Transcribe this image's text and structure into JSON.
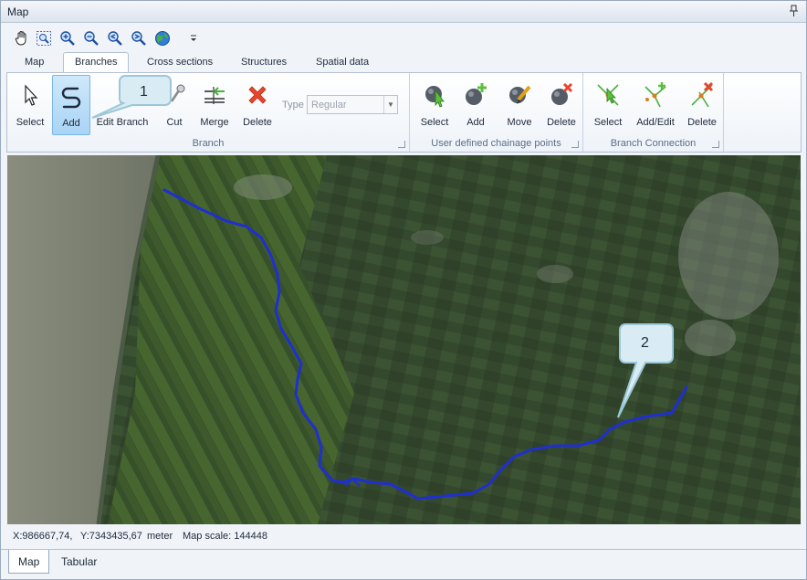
{
  "window": {
    "title": "Map"
  },
  "map_toolbar": {
    "icons": [
      "pan-icon",
      "zoom-box-icon",
      "zoom-in-icon",
      "zoom-out-icon",
      "zoom-previous-icon",
      "zoom-next-icon",
      "globe-icon",
      "dropdown-arrow-icon"
    ]
  },
  "tabs": [
    {
      "label": "Map",
      "active": false
    },
    {
      "label": "Branches",
      "active": true
    },
    {
      "label": "Cross sections",
      "active": false
    },
    {
      "label": "Structures",
      "active": false
    },
    {
      "label": "Spatial data",
      "active": false
    }
  ],
  "ribbon": {
    "branch_group": {
      "label": "Branch",
      "buttons": {
        "select": "Select",
        "add": "Add",
        "edit_branch": "Edit Branch",
        "cut": "Cut",
        "merge": "Merge",
        "delete": "Delete"
      },
      "type_label": "Type",
      "type_value": "Regular"
    },
    "chainage_group": {
      "label": "User defined chainage points",
      "buttons": {
        "select": "Select",
        "add": "Add",
        "move": "Move",
        "delete": "Delete"
      }
    },
    "connection_group": {
      "label": "Branch Connection",
      "buttons": {
        "select": "Select",
        "add_edit": "Add/Edit",
        "delete": "Delete"
      }
    }
  },
  "callouts": {
    "one": "1",
    "two": "2"
  },
  "status": {
    "x": "X:986667,74,",
    "y": "Y:7343435,67",
    "unit": "meter",
    "scale": "Map scale: 144448"
  },
  "bottom_tabs": [
    {
      "label": "Map",
      "active": true
    },
    {
      "label": "Tabular",
      "active": false
    }
  ],
  "colors": {
    "branch_line": "#1f2fd0",
    "callout_fill": "#d9ecf3",
    "delete_red": "#e8452c",
    "chainage_green": "#5bbf3c"
  }
}
